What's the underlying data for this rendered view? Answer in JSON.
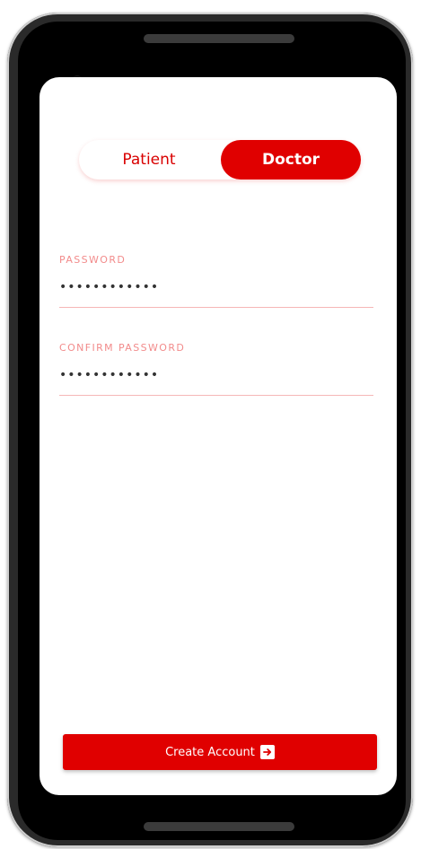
{
  "role_toggle": {
    "patient_label": "Patient",
    "doctor_label": "Doctor",
    "selected": "Doctor"
  },
  "password_field": {
    "label": "PASSWORD",
    "value": "hunter2pass1"
  },
  "confirm_password_field": {
    "label": "CONFIRM PASSWORD",
    "value": "hunter2pass1"
  },
  "create_account_button": {
    "label": "Create Account",
    "icon": "arrow-right-icon"
  },
  "colors": {
    "accent": "#e00000",
    "label": "#f28b8b",
    "underline": "#f6b7b7"
  }
}
